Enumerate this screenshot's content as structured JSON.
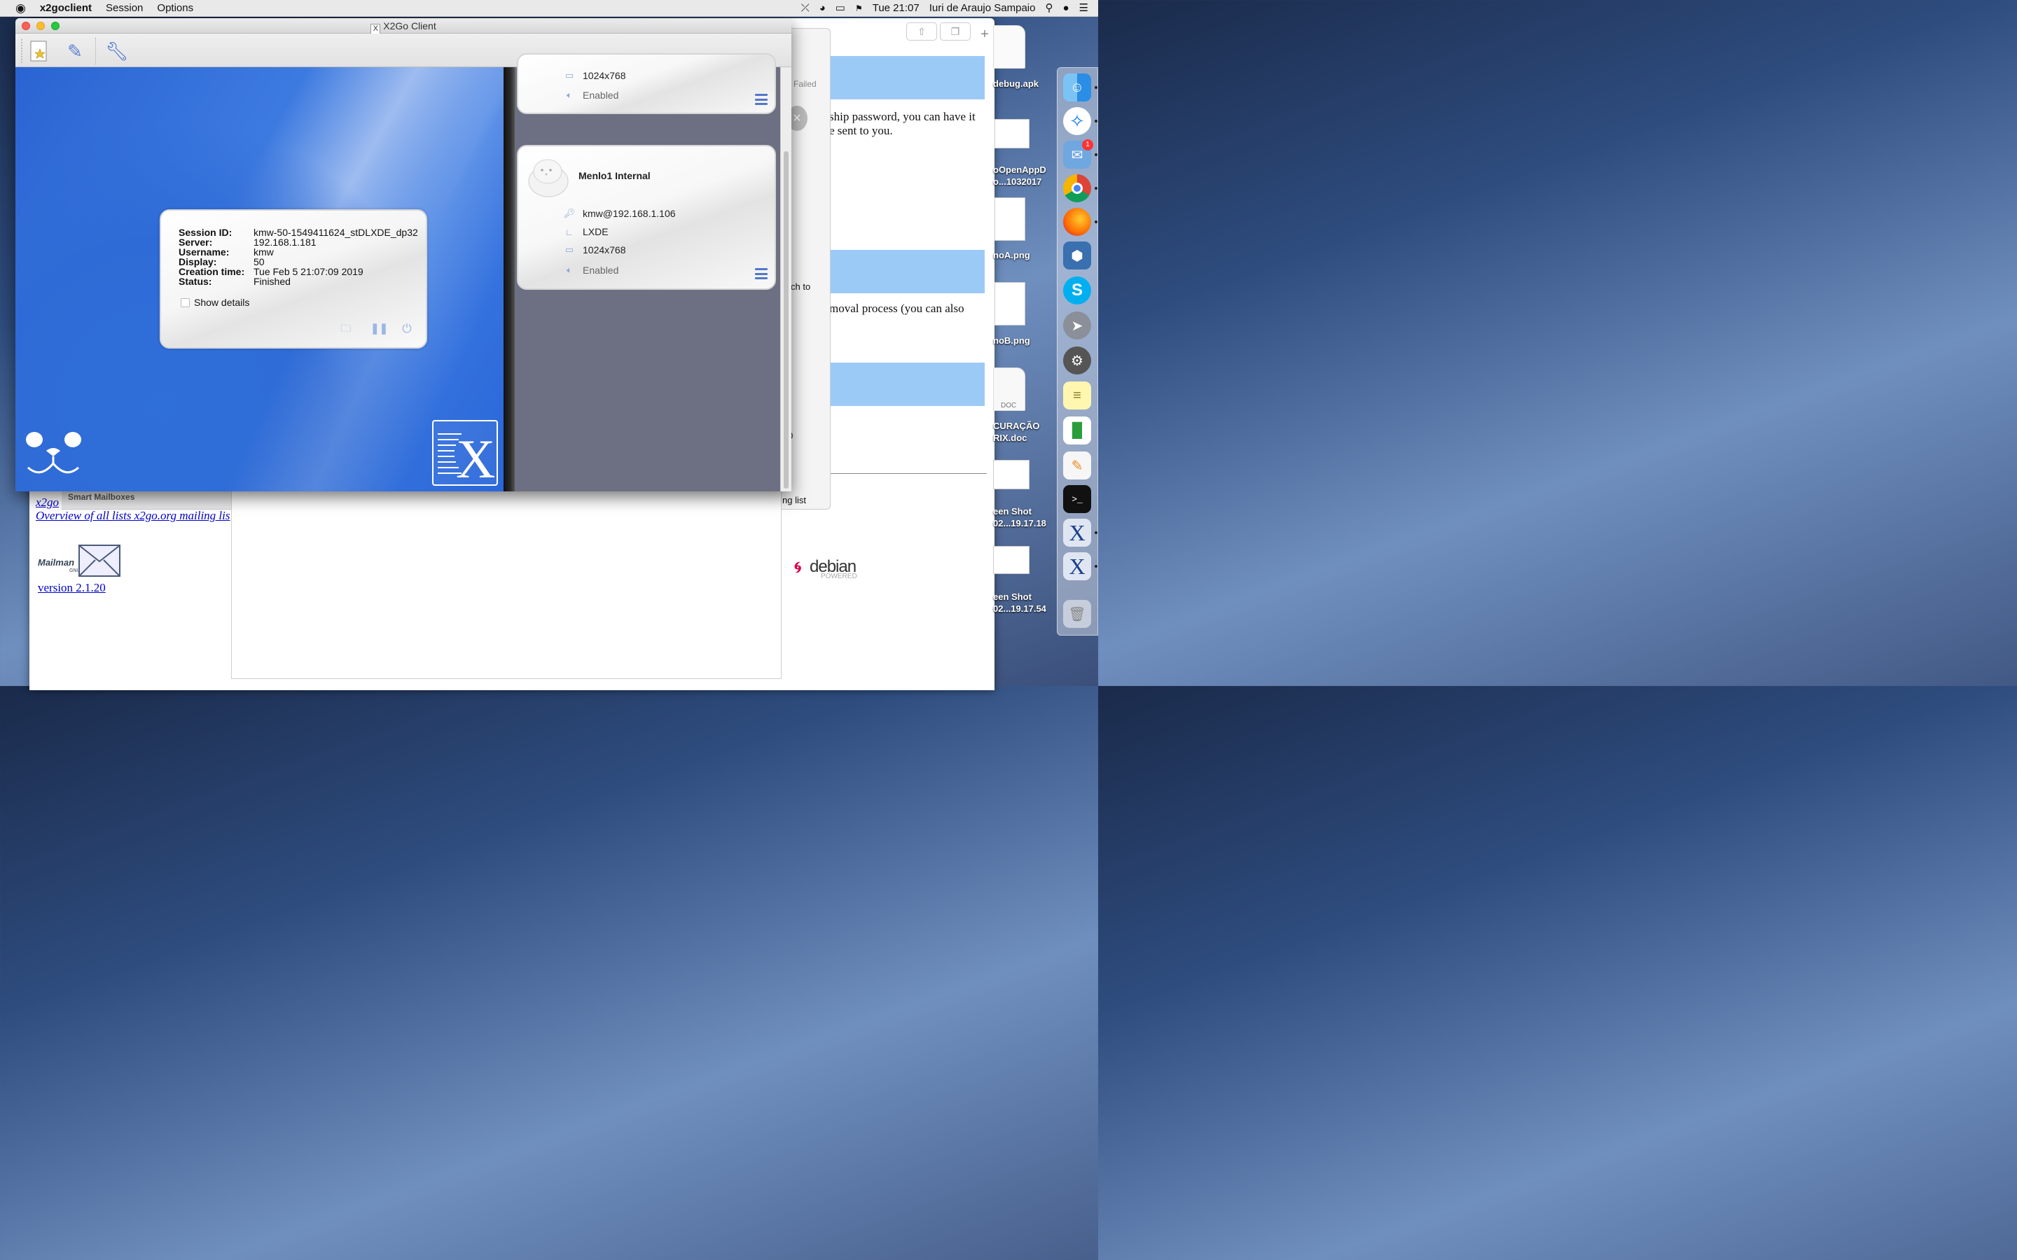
{
  "menubar": {
    "apple": "",
    "app_name": "x2goclient",
    "menus": [
      "Session",
      "Options"
    ],
    "clock": "Tue 21:07",
    "user": "Iuri de Araujo Sampaio"
  },
  "window": {
    "title": "X2Go Client"
  },
  "session_dialog": {
    "fields": [
      {
        "key": "Session ID:",
        "value": "kmw-50-1549411624_stDLXDE_dp32"
      },
      {
        "key": "Server:",
        "value": "192.168.1.181"
      },
      {
        "key": "Username:",
        "value": "kmw"
      },
      {
        "key": "Display:",
        "value": "50"
      },
      {
        "key": "Creation time:",
        "value": "Tue Feb 5 21:07:09 2019"
      },
      {
        "key": "Status:",
        "value": "Finished"
      }
    ],
    "show_details_label": "Show details"
  },
  "sessions": [
    {
      "name": "",
      "resolution": "1024x768",
      "sound": "Enabled"
    },
    {
      "name": "Menlo1 Internal",
      "login": "kmw@192.168.1.106",
      "desktop": "LXDE",
      "resolution": "1024x768",
      "sound": "Enabled"
    }
  ],
  "background_browser": {
    "text_1": "ship password, you can have it",
    "text_2": "e sent to you.",
    "text_3": "moval process (you can also",
    "link_overview": "Overview of all lists x2go.org mailing lis",
    "link_prefix": "x2go",
    "version_link": "version 2.1.20",
    "mailman_label": "Mailman",
    "gnu_label": "GNU",
    "debian_label": "debian",
    "debian_sub": "POWERED"
  },
  "mail_window": {
    "smart_mailboxes": "Smart Mailboxes"
  },
  "doc_window": {
    "failed_label": "Failed",
    "snippet_1": "ch to",
    "snippet_2": "ng list",
    "snippet_3": "0",
    "snippet_4": ":"
  },
  "desktop_files": [
    {
      "label": "debug.apk"
    },
    {
      "label": "oOpenAppD\no...1032017"
    },
    {
      "label": "noA.png"
    },
    {
      "label": "noB.png"
    },
    {
      "label": "CURAÇÃO\nRIX.doc"
    },
    {
      "label": "een Shot\n02...19.17.18"
    },
    {
      "label": "een Shot\n02...19.17.54"
    }
  ],
  "doc_icon_label": "DOC",
  "dock": {
    "mail_badge": "1"
  }
}
